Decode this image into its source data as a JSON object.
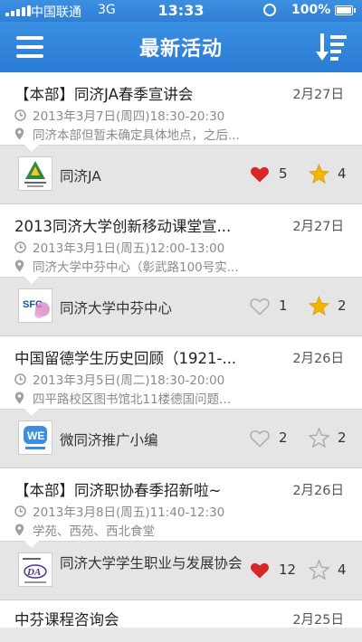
{
  "status": {
    "carrier": "中国联通",
    "network": "3G",
    "time": "13:33",
    "battery": "100%"
  },
  "navbar": {
    "title": "最新活动",
    "menu_icon": "hamburger-menu-icon",
    "sort_icon": "sort-descending-icon"
  },
  "colors": {
    "accent": "#2f80d6",
    "heart_active": "#d9262a",
    "star_active": "#f2b600",
    "icon_inactive": "#aaaaaa"
  },
  "events": [
    {
      "title": "【本部】同济JA春季宣讲会",
      "date": "2月27日",
      "time": "2013年3月7日(周四)18:30-20:30",
      "location": "同济本部但暂未确定具体地点，之后...",
      "org": "同济JA",
      "likes": "5",
      "liked": true,
      "favs": "4",
      "faved": true
    },
    {
      "title": "2013同济大学创新移动课堂宣...",
      "date": "2月27日",
      "time": "2013年3月1日(周五)12:00-13:00",
      "location": "同济大学中芬中心（彰武路100号实...",
      "org": "同济大学中芬中心",
      "likes": "1",
      "liked": false,
      "favs": "2",
      "faved": true
    },
    {
      "title": "中国留德学生历史回顾（1921-...",
      "date": "2月26日",
      "time": "2013年3月5日(周二)18:30-20:00",
      "location": "四平路校区图书馆北11楼德国问题...",
      "org": "微同济推广小编",
      "likes": "2",
      "liked": false,
      "favs": "2",
      "faved": false
    },
    {
      "title": "【本部】同济职协春季招新啦~",
      "date": "2月26日",
      "time": "2013年3月8日(周五)11:40-12:30",
      "location": "学苑、西苑、西北食堂",
      "org": "同济大学学生职业与发展协会",
      "likes": "12",
      "liked": true,
      "favs": "4",
      "faved": false
    }
  ],
  "partial_event": {
    "title": "中芬课程咨询会",
    "date": "2月25日"
  }
}
